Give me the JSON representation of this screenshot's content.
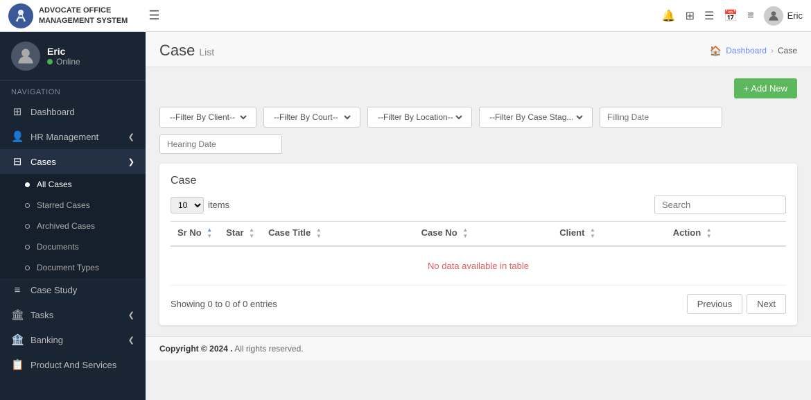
{
  "brand": {
    "icon_label": "advocate-logo",
    "name_line1": "ADVOCATE OFFICE",
    "name_line2": "MANAGEMENT SYSTEM"
  },
  "topbar": {
    "icons": [
      "notification-icon",
      "grid-icon",
      "list-icon",
      "calendar-icon",
      "menu-icon",
      "user-settings-icon"
    ],
    "user_name": "Eric"
  },
  "sidebar": {
    "user": {
      "name": "Eric",
      "status": "Online"
    },
    "nav_label": "Navigation",
    "items": [
      {
        "id": "dashboard",
        "label": "Dashboard",
        "icon": "⊞",
        "has_arrow": false
      },
      {
        "id": "hr-management",
        "label": "HR Management",
        "icon": "👤",
        "has_arrow": true
      },
      {
        "id": "cases",
        "label": "Cases",
        "icon": "⊟",
        "has_arrow": true,
        "active": true
      }
    ],
    "cases_sub_items": [
      {
        "id": "all-cases",
        "label": "All Cases",
        "active": true
      },
      {
        "id": "starred-cases",
        "label": "Starred Cases",
        "active": false
      },
      {
        "id": "archived-cases",
        "label": "Archived Cases",
        "active": false
      },
      {
        "id": "documents",
        "label": "Documents",
        "active": false
      },
      {
        "id": "document-types",
        "label": "Document Types",
        "active": false
      }
    ],
    "bottom_items": [
      {
        "id": "case-study",
        "label": "Case Study",
        "icon": "≡"
      },
      {
        "id": "tasks",
        "label": "Tasks",
        "icon": "🏛",
        "has_arrow": true
      },
      {
        "id": "banking",
        "label": "Banking",
        "icon": "🏦",
        "has_arrow": true
      },
      {
        "id": "product-services",
        "label": "Product And Services",
        "icon": "📋"
      }
    ]
  },
  "page": {
    "title_main": "Case",
    "title_sub": "List",
    "breadcrumb_home": "Dashboard",
    "breadcrumb_current": "Case"
  },
  "add_new_btn": "+ Add New",
  "filters": {
    "client_placeholder": "--Filter By Client--",
    "court_placeholder": "--Filter By Court--",
    "location_placeholder": "--Filter By Location--",
    "case_stage_placeholder": "--Filter By Case Stag...",
    "filling_date_placeholder": "Filling Date",
    "hearing_date_placeholder": "Hearing Date"
  },
  "case_table": {
    "section_title": "Case",
    "items_label": "items",
    "items_count": "10",
    "search_placeholder": "Search",
    "columns": [
      {
        "key": "sr_no",
        "label": "Sr No"
      },
      {
        "key": "star",
        "label": "Star"
      },
      {
        "key": "case_title",
        "label": "Case Title"
      },
      {
        "key": "case_no",
        "label": "Case No"
      },
      {
        "key": "client",
        "label": "Client"
      },
      {
        "key": "action",
        "label": "Action"
      }
    ],
    "no_data_message": "No data available in table",
    "showing_text": "Showing 0 to 0 of 0 entries",
    "pagination": {
      "previous": "Previous",
      "next": "Next"
    }
  },
  "footer": {
    "copyright": "Copyright © 2024 .",
    "rights": "All rights reserved."
  }
}
